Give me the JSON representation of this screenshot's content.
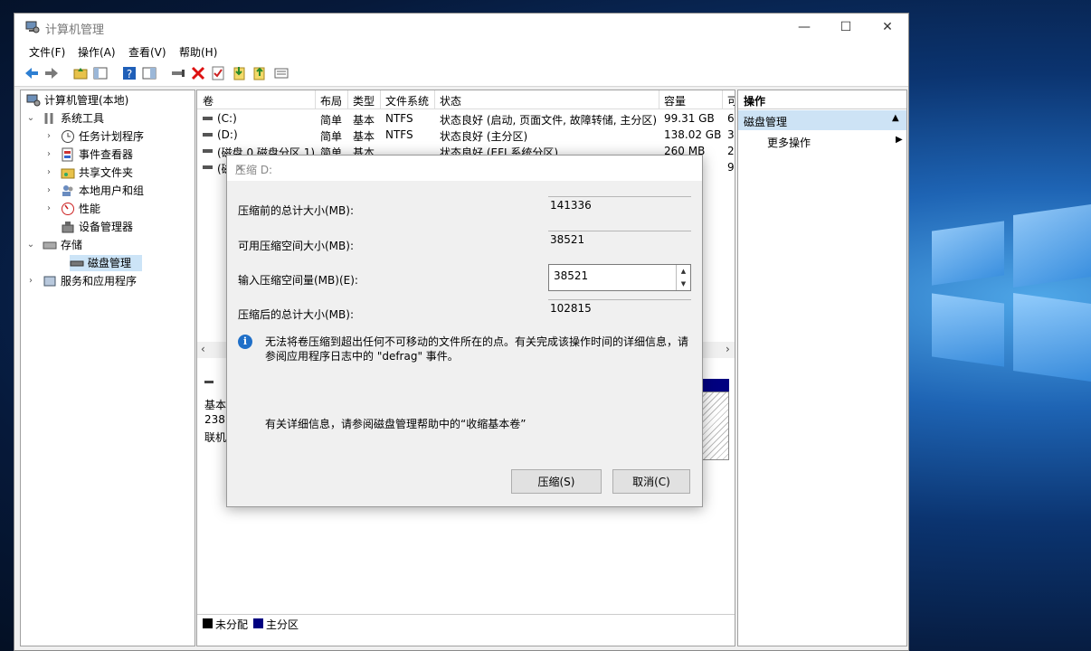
{
  "window": {
    "title": "计算机管理",
    "controls": {
      "minimize": "—",
      "maximize": "☐",
      "close": "✕"
    }
  },
  "menu": {
    "file": "文件(F)",
    "action": "操作(A)",
    "view": "查看(V)",
    "help": "帮助(H)"
  },
  "tree": {
    "root": "计算机管理(本地)",
    "system_tools": "系统工具",
    "task_scheduler": "任务计划程序",
    "event_viewer": "事件查看器",
    "shared_folders": "共享文件夹",
    "local_users": "本地用户和组",
    "performance": "性能",
    "device_manager": "设备管理器",
    "storage": "存储",
    "disk_management": "磁盘管理",
    "services_apps": "服务和应用程序"
  },
  "volume_list": {
    "headers": {
      "volume": "卷",
      "layout": "布局",
      "type": "类型",
      "fs": "文件系统",
      "status": "状态",
      "capacity": "容量",
      "free": "可"
    },
    "rows": [
      {
        "volume": "(C:)",
        "layout": "简单",
        "type": "基本",
        "fs": "NTFS",
        "status": "状态良好 (启动, 页面文件, 故障转储, 主分区)",
        "capacity": "99.31 GB",
        "free": "6"
      },
      {
        "volume": "(D:)",
        "layout": "简单",
        "type": "基本",
        "fs": "NTFS",
        "status": "状态良好 (主分区)",
        "capacity": "138.02 GB",
        "free": "3"
      },
      {
        "volume": "(磁盘 0 磁盘分区 1)",
        "layout": "简单",
        "type": "基本",
        "fs": "",
        "status": "状态良好 (EFI 系统分区)",
        "capacity": "260 MB",
        "free": "2"
      },
      {
        "volume": "(磁",
        "layout": "",
        "type": "",
        "fs": "",
        "status": "",
        "capacity": "",
        "free": "9"
      }
    ]
  },
  "disk_pane": {
    "line1": "基本",
    "line2": "238.",
    "line3": "联机"
  },
  "legend": {
    "unallocated": "未分配",
    "primary": "主分区"
  },
  "actions": {
    "header": "操作",
    "selected": "磁盘管理",
    "more": "更多操作"
  },
  "dialog": {
    "title": "压缩 D:",
    "total_before_label": "压缩前的总计大小(MB):",
    "total_before_value": "141336",
    "available_label": "可用压缩空间大小(MB):",
    "available_value": "38521",
    "input_label": "输入压缩空间量(MB)(E):",
    "input_value": "38521",
    "total_after_label": "压缩后的总计大小(MB):",
    "total_after_value": "102815",
    "info_text": "无法将卷压缩到超出任何不可移动的文件所在的点。有关完成该操作时间的详细信息，请参阅应用程序日志中的 \"defrag\" 事件。",
    "help_text": "有关详细信息，请参阅磁盘管理帮助中的“收缩基本卷”",
    "shrink_button": "压缩(S)",
    "cancel_button": "取消(C)"
  },
  "colors": {
    "unallocated": "#000000",
    "primary": "#000080",
    "accent": "#1f6fc8"
  }
}
